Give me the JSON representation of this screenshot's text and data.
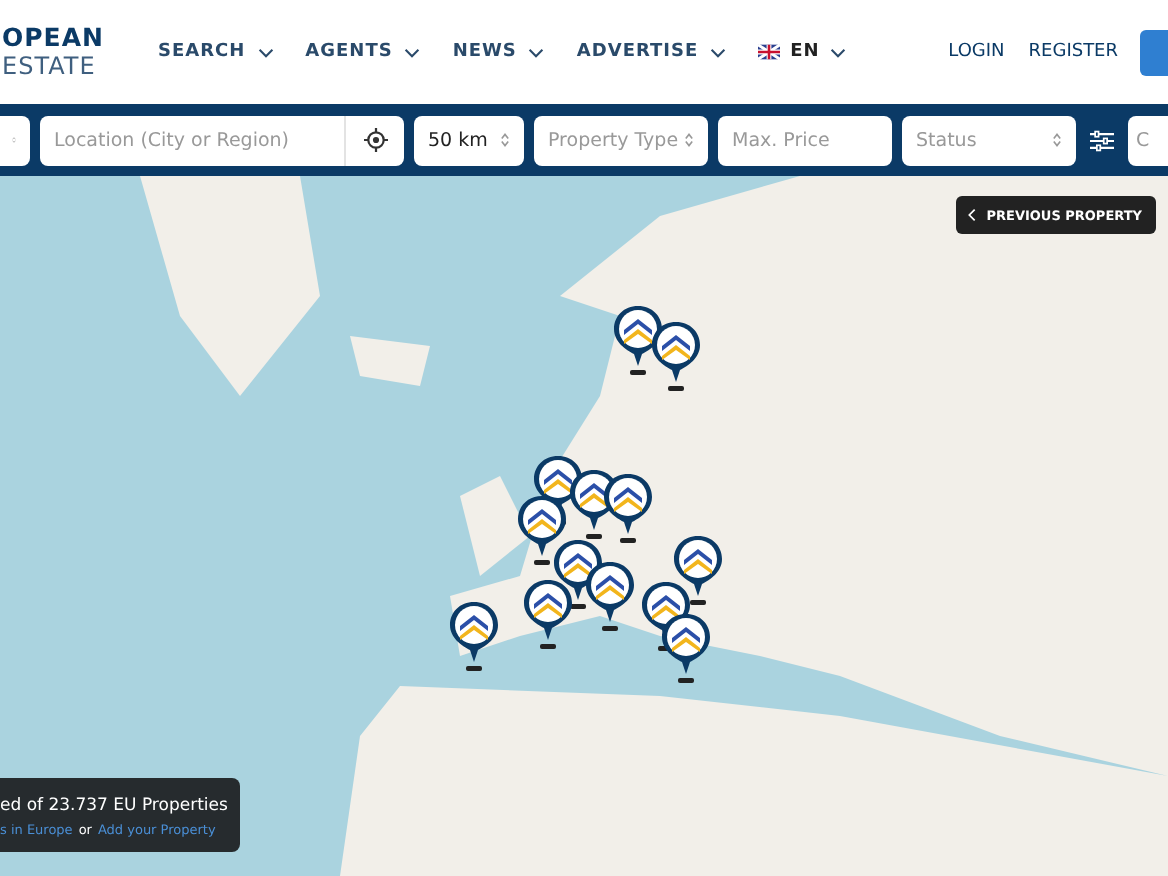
{
  "logo": {
    "line_1": "OPEAN",
    "line_2": "ESTATE"
  },
  "nav": [
    {
      "label": "SEARCH"
    },
    {
      "label": "AGENTS"
    },
    {
      "label": "NEWS"
    },
    {
      "label": "ADVERTISE"
    }
  ],
  "language": {
    "label": "EN"
  },
  "account_links": [
    "LOGIN",
    "REGISTER"
  ],
  "filters": [
    {
      "kind": "select"
    },
    {
      "kind": "location",
      "placeholder": "Location (City or Region)"
    },
    {
      "kind": "select",
      "value": "50 km"
    },
    {
      "kind": "select",
      "placeholder": "Property Type"
    },
    {
      "kind": "input",
      "placeholder": "Max. Price"
    },
    {
      "kind": "select",
      "placeholder": "Status"
    },
    {
      "kind": "options"
    },
    {
      "kind": "input",
      "placeholder": "C"
    }
  ],
  "map": {
    "previous_button": "PREVIOUS PROPERTY",
    "info": {
      "title": "ed of 23.737 EU Properties",
      "link_1": "s in Europe",
      "joiner": "or",
      "link_2": "Add your Property"
    }
  }
}
